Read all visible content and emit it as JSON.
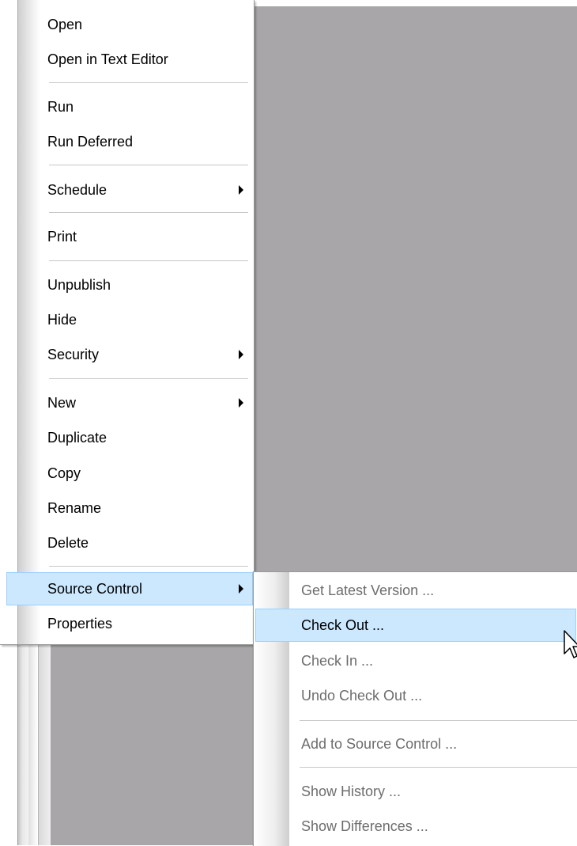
{
  "context_menu": {
    "items": [
      {
        "label": "Open"
      },
      {
        "label": "Open in Text Editor"
      },
      {
        "label": "Run"
      },
      {
        "label": "Run Deferred"
      },
      {
        "label": "Schedule",
        "submenu": true
      },
      {
        "label": "Print"
      },
      {
        "label": "Unpublish"
      },
      {
        "label": "Hide"
      },
      {
        "label": "Security",
        "submenu": true
      },
      {
        "label": "New",
        "submenu": true
      },
      {
        "label": "Duplicate"
      },
      {
        "label": "Copy"
      },
      {
        "label": "Rename"
      },
      {
        "label": "Delete"
      },
      {
        "label": "Source Control",
        "submenu": true,
        "highlighted": true
      },
      {
        "label": "Properties"
      }
    ]
  },
  "source_control_submenu": {
    "items": [
      {
        "label": "Get Latest Version ...",
        "enabled": false
      },
      {
        "label": "Check Out ...",
        "enabled": true,
        "highlighted": true
      },
      {
        "label": "Check In ...",
        "enabled": false
      },
      {
        "label": "Undo Check Out ...",
        "enabled": false
      },
      {
        "label": "Add to Source Control ...",
        "enabled": false
      },
      {
        "label": "Show History ...",
        "enabled": false
      },
      {
        "label": "Show Differences ...",
        "enabled": false
      }
    ]
  },
  "colors": {
    "highlight_fill": "#cce8ff",
    "highlight_border": "#99d1ff",
    "workspace": "#a8a6a8",
    "disabled_text": "#6d6d6d"
  },
  "icons": {
    "submenu_arrow": "triangle-right",
    "cursor": "mouse-pointer"
  }
}
